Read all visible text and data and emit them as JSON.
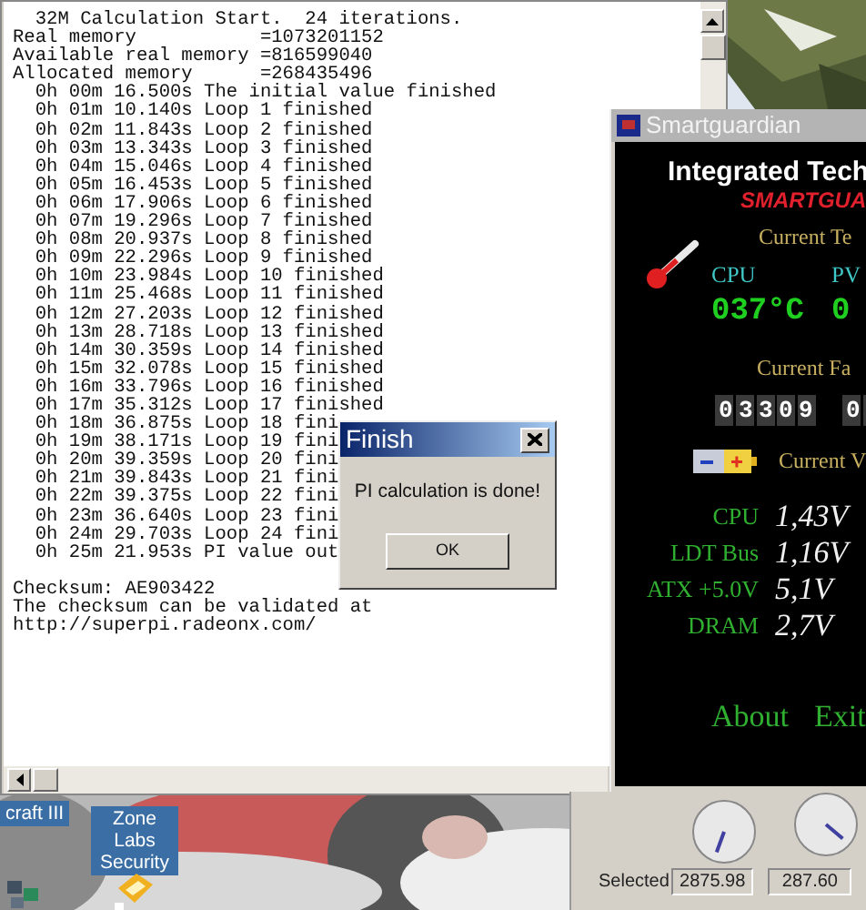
{
  "console_window": {
    "lines": [
      "  32M Calculation Start.  24 iterations.",
      "Real memory           =1073201152",
      "Available real memory =816599040",
      "Allocated memory      =268435496",
      "  0h 00m 16.500s The initial value finished",
      "  0h 01m 10.140s Loop 1 finished",
      "  0h 02m 11.843s Loop 2 finished",
      "  0h 03m 13.343s Loop 3 finished",
      "  0h 04m 15.046s Loop 4 finished",
      "  0h 05m 16.453s Loop 5 finished",
      "  0h 06m 17.906s Loop 6 finished",
      "  0h 07m 19.296s Loop 7 finished",
      "  0h 08m 20.937s Loop 8 finished",
      "  0h 09m 22.296s Loop 9 finished",
      "  0h 10m 23.984s Loop 10 finished",
      "  0h 11m 25.468s Loop 11 finished",
      "  0h 12m 27.203s Loop 12 finished",
      "  0h 13m 28.718s Loop 13 finished",
      "  0h 14m 30.359s Loop 14 finished",
      "  0h 15m 32.078s Loop 15 finished",
      "  0h 16m 33.796s Loop 16 finished",
      "  0h 17m 35.312s Loop 17 finished",
      "  0h 18m 36.875s Loop 18 fini",
      "  0h 19m 38.171s Loop 19 fini",
      "  0h 20m 39.359s Loop 20 fini",
      "  0h 21m 39.843s Loop 21 fini",
      "  0h 22m 39.375s Loop 22 fini",
      "  0h 23m 36.640s Loop 23 fini",
      "  0h 24m 29.703s Loop 24 fini",
      "  0h 25m 21.953s PI value out"
    ],
    "footer_lines": [
      "Checksum: AE903422",
      "The checksum can be validated at",
      "http://superpi.radeonx.com/"
    ]
  },
  "finish_dialog": {
    "title": "Finish",
    "message": "PI calculation is done!",
    "button": "OK"
  },
  "smartguardian": {
    "title": "Smartguardian",
    "heading": "Integrated Tech",
    "brand": "SMARTGUA",
    "temperature": {
      "section": "Current Te",
      "sensors": [
        {
          "label": "CPU",
          "value": "037°C"
        },
        {
          "label": "PV",
          "value": "0"
        }
      ]
    },
    "fans": {
      "section": "Current Fa",
      "readings": [
        "03309",
        "0"
      ]
    },
    "voltage": {
      "section": "Current V",
      "rows": [
        {
          "label": "CPU",
          "value": "1,43V"
        },
        {
          "label": "LDT Bus",
          "value": "1,16V"
        },
        {
          "label": "ATX +5.0V",
          "value": "5,1V"
        },
        {
          "label": "DRAM",
          "value": "2,7V"
        }
      ]
    },
    "buttons": [
      "About",
      "Exit"
    ]
  },
  "desktop_icons": [
    {
      "label": "craft III"
    },
    {
      "label": "Zone Labs Security"
    }
  ],
  "meter_panel": {
    "label": "Selected",
    "fields": [
      "2875.98",
      "287.60"
    ]
  }
}
